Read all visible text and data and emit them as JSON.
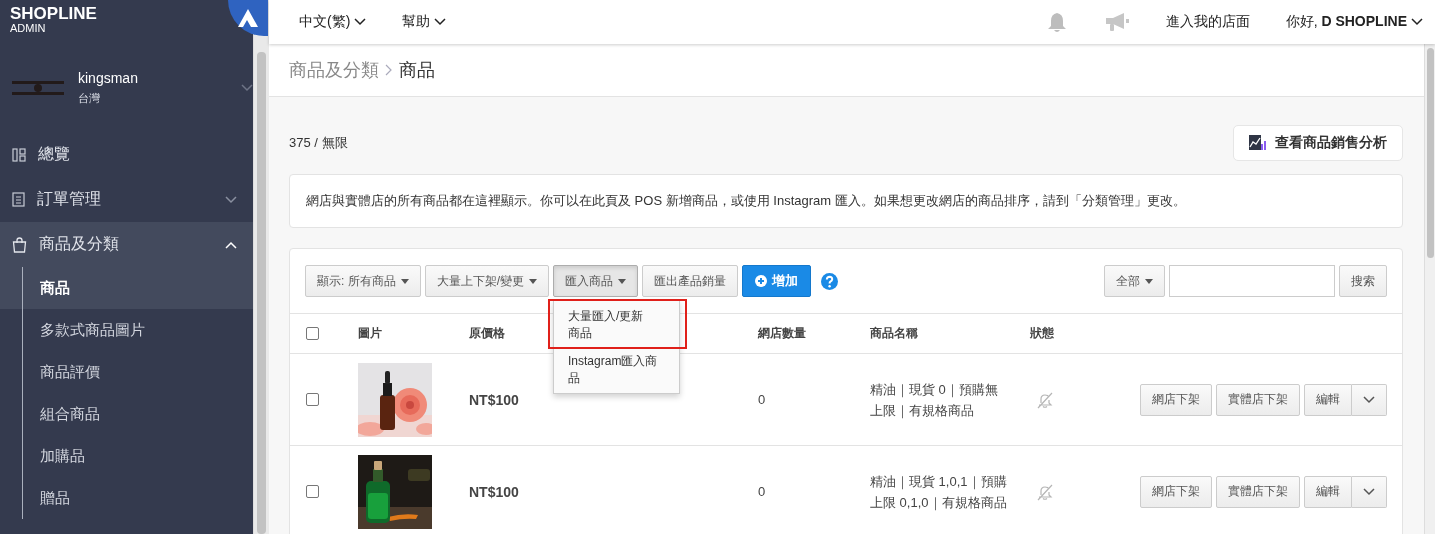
{
  "brand": {
    "name": "SHOPLINE",
    "sub": "ADMIN"
  },
  "store": {
    "name": "kingsman",
    "region": "台灣"
  },
  "sidebar": {
    "items": [
      {
        "label": "總覽",
        "kind": "overview",
        "selected": false
      },
      {
        "label": "訂單管理",
        "kind": "orders",
        "expanded": false,
        "selected": false
      },
      {
        "label": "商品及分類",
        "kind": "products",
        "expanded": true,
        "selected": true,
        "children": [
          {
            "label": "商品",
            "selected": true
          },
          {
            "label": "多款式商品圖片",
            "selected": false
          },
          {
            "label": "商品評價",
            "selected": false
          },
          {
            "label": "組合商品",
            "selected": false
          },
          {
            "label": "加購品",
            "selected": false
          },
          {
            "label": "贈品",
            "selected": false
          }
        ]
      }
    ]
  },
  "topbar": {
    "menus": [
      "中文(繁)",
      "幫助"
    ],
    "store_link": "進入我的店面",
    "greeting": "你好, **D SHOPLINE**"
  },
  "breadcrumb": [
    "商品及分類",
    "商品"
  ],
  "count": "375 / 無限",
  "analysis_button": "查看商品銷售分析",
  "notice": "網店與實體店的所有商品都在這裡顯示。你可以在此頁及 POS 新增商品，或使用 Instagram 匯入。如果想更改網店的商品排序，請到「分類管理」更改。",
  "toolbar": {
    "buttons": [
      {
        "label": "顯示: 所有商品",
        "kind": "dropdown"
      },
      {
        "label": "大量上下架/變更",
        "kind": "dropdown"
      },
      {
        "label": "匯入商品",
        "kind": "dropdown",
        "menu": {
          "items": [
            {
              "label": "大量匯入/更新商品",
              "highlighted": true
            },
            {
              "label": "Instagram匯入商品",
              "highlighted": false
            }
          ]
        }
      },
      {
        "label": "匯出產品銷量",
        "kind": "plain"
      },
      {
        "label": "增加",
        "kind": "primary"
      }
    ],
    "filter": "全部",
    "search_button": "搜索"
  },
  "table": {
    "select_all_checked": false,
    "columns": [
      "圖片",
      "原價格",
      "網店數量",
      "商品名稱",
      "狀態"
    ],
    "rows": [
      {
        "checked": false,
        "kind": "picture",
        "price": "NT$100",
        "quantity": "0",
        "name": "精油｜現貨 0｜預購無上限｜有規格商品",
        "actions": [
          "網店下架",
          "實體店下架",
          "編輯"
        ]
      },
      {
        "checked": false,
        "kind": "picture",
        "price": "NT$100",
        "quantity": "0",
        "name": "精油｜現貨 1,0,1｜預購上限 0,1,0｜有規格商品",
        "actions": [
          "網店下架",
          "實體店下架",
          "編輯"
        ]
      }
    ]
  }
}
